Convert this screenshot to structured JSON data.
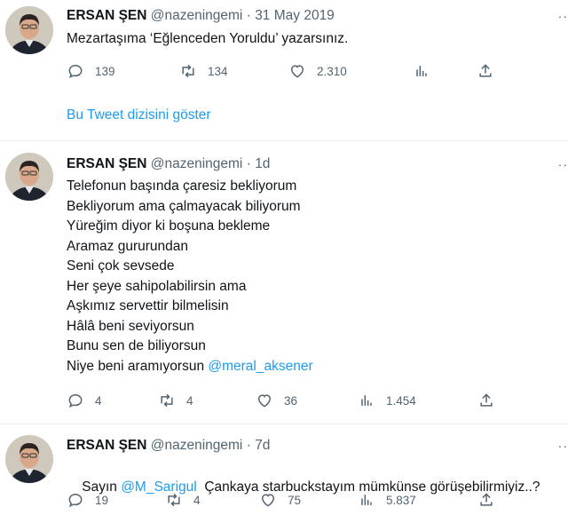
{
  "tweets": [
    {
      "name": "ERSAN ŞEN",
      "handle": "@nazeningemi",
      "sep": "·",
      "time": "31 May 2019",
      "text": [
        "Mezartaşıma ‘Eğlenceden Yoruldu’ yazarsınız."
      ],
      "replies": "139",
      "retweets": "134",
      "likes": "2.310",
      "views": "",
      "show_thread": "Bu Tweet dizisini göster"
    },
    {
      "name": "ERSAN ŞEN",
      "handle": "@nazeningemi",
      "sep": "·",
      "time": "1d",
      "text": [
        "Telefonun başında çaresiz bekliyorum",
        "Bekliyorum ama çalmayacak biliyorum",
        "Yüreğim diyor ki boşuna bekleme",
        "Aramaz gururundan",
        "Seni çok sevsede",
        "Her şeye sahipolabilirsin ama",
        "Aşkımız servettir bilmelisin",
        "Hâlâ beni seviyorsun",
        "Bunu sen de biliyorsun",
        "Niye beni aramıyorsun "
      ],
      "mention": "@meral_aksener",
      "replies": "4",
      "retweets": "4",
      "likes": "36",
      "views": "1.454"
    },
    {
      "name": "ERSAN ŞEN",
      "handle": "@nazeningemi",
      "sep": "·",
      "time": "7d",
      "text_prefix": "Sayın ",
      "mention": "@M_Sarigul",
      "text_suffix": "  Çankaya starbuckstayım mümkünse görüşebilirmiyiz..?",
      "replies": "19",
      "retweets": "4",
      "likes": "75",
      "views": "5.837"
    }
  ],
  "more_label": "··",
  "colors": {
    "link": "#1d9bf0",
    "muted": "#536471",
    "divider": "#e6ecf0"
  }
}
